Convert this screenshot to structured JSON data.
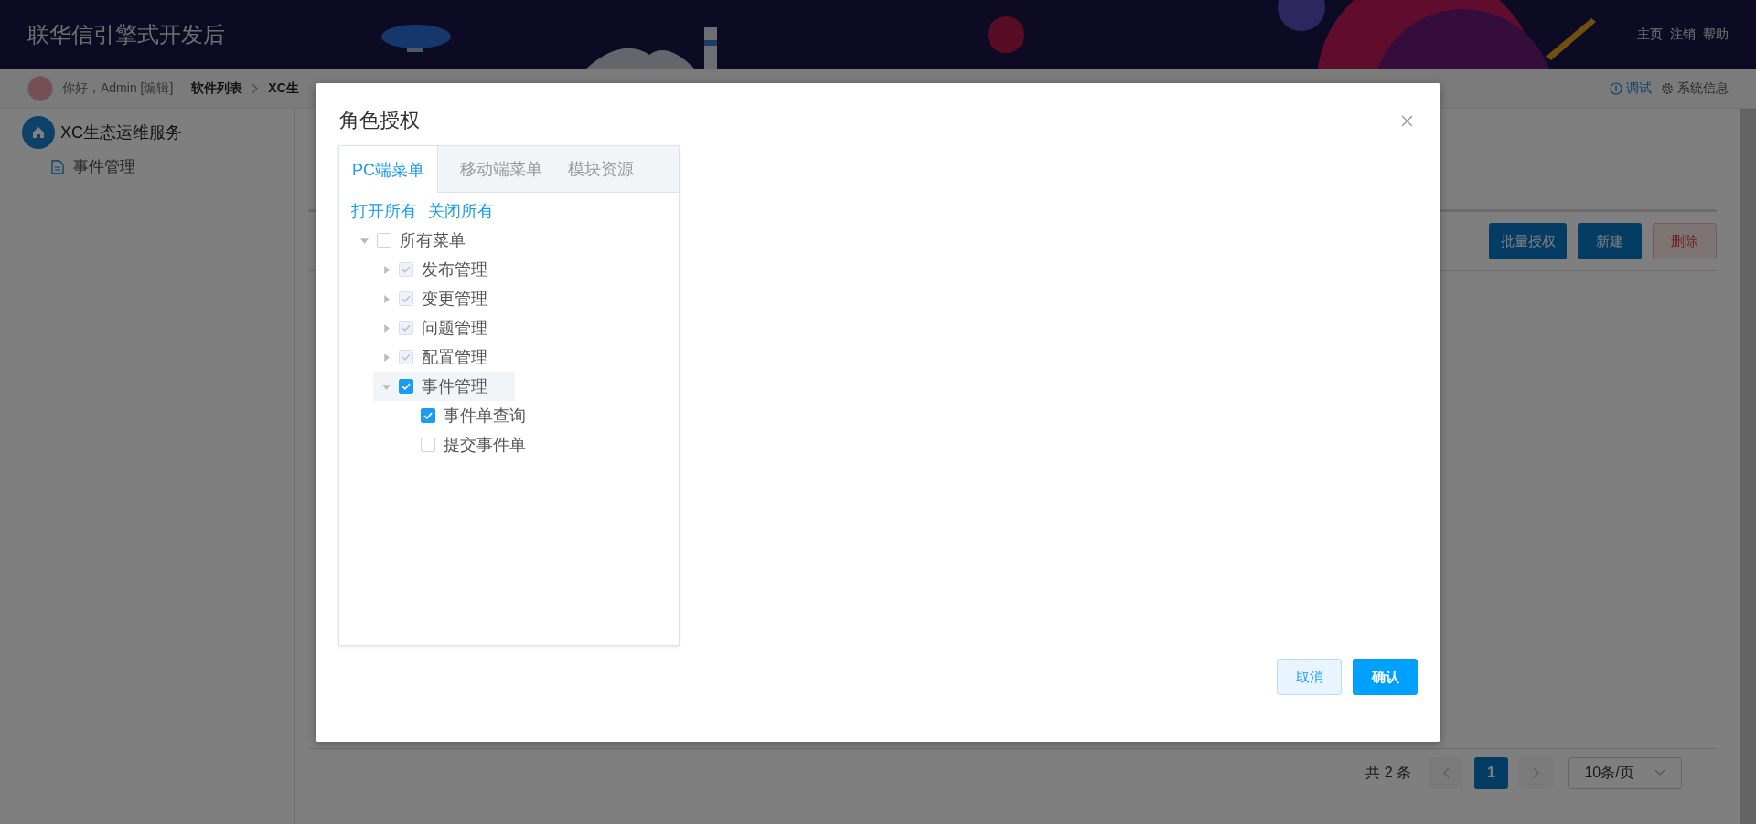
{
  "header": {
    "title": "联华信引擎式开发后",
    "links": [
      "主页",
      "注销",
      "帮助"
    ]
  },
  "breadcrumb": {
    "greeting": "你好，Admin [编辑]",
    "items": [
      "软件列表",
      "XC生"
    ],
    "actions": [
      {
        "label": "调试",
        "kind": "info"
      },
      {
        "label": "系统信息",
        "kind": "gear"
      }
    ]
  },
  "sidebar": {
    "service": "XC生态运维服务",
    "items": [
      {
        "label": "事件管理"
      }
    ]
  },
  "toolbar": {
    "buttons": [
      {
        "label": "批量授权",
        "kind": "primary"
      },
      {
        "label": "新建",
        "kind": "primary"
      },
      {
        "label": "删除",
        "kind": "danger"
      }
    ]
  },
  "pagination": {
    "total": "共 2 条",
    "pages": [
      {
        "label": "1",
        "selected": true
      }
    ],
    "page_size": "10条/页"
  },
  "dialog": {
    "title": "角色授权",
    "tabs": [
      {
        "label": "PC端菜单",
        "selected": true
      },
      {
        "label": "移动端菜单",
        "selected": false
      },
      {
        "label": "模块资源",
        "selected": false
      }
    ],
    "links": [
      "打开所有",
      "关闭所有"
    ],
    "tree": [
      {
        "label": "所有菜单",
        "checked": false,
        "disabled": false,
        "expanded": true,
        "selected": false,
        "children": [
          {
            "label": "发布管理",
            "checked": true,
            "disabled": true,
            "expanded": false,
            "selected": false
          },
          {
            "label": "变更管理",
            "checked": true,
            "disabled": true,
            "expanded": false,
            "selected": false
          },
          {
            "label": "问题管理",
            "checked": true,
            "disabled": true,
            "expanded": false,
            "selected": false
          },
          {
            "label": "配置管理",
            "checked": true,
            "disabled": true,
            "expanded": false,
            "selected": false
          },
          {
            "label": "事件管理",
            "checked": true,
            "disabled": false,
            "expanded": true,
            "selected": true,
            "children": [
              {
                "label": "事件单查询",
                "checked": true,
                "disabled": false,
                "selected": false
              },
              {
                "label": "提交事件单",
                "checked": false,
                "disabled": false,
                "selected": false
              }
            ]
          }
        ]
      }
    ],
    "buttons": [
      {
        "label": "取消",
        "kind": "secondary"
      },
      {
        "label": "确认",
        "kind": "primary"
      }
    ]
  }
}
